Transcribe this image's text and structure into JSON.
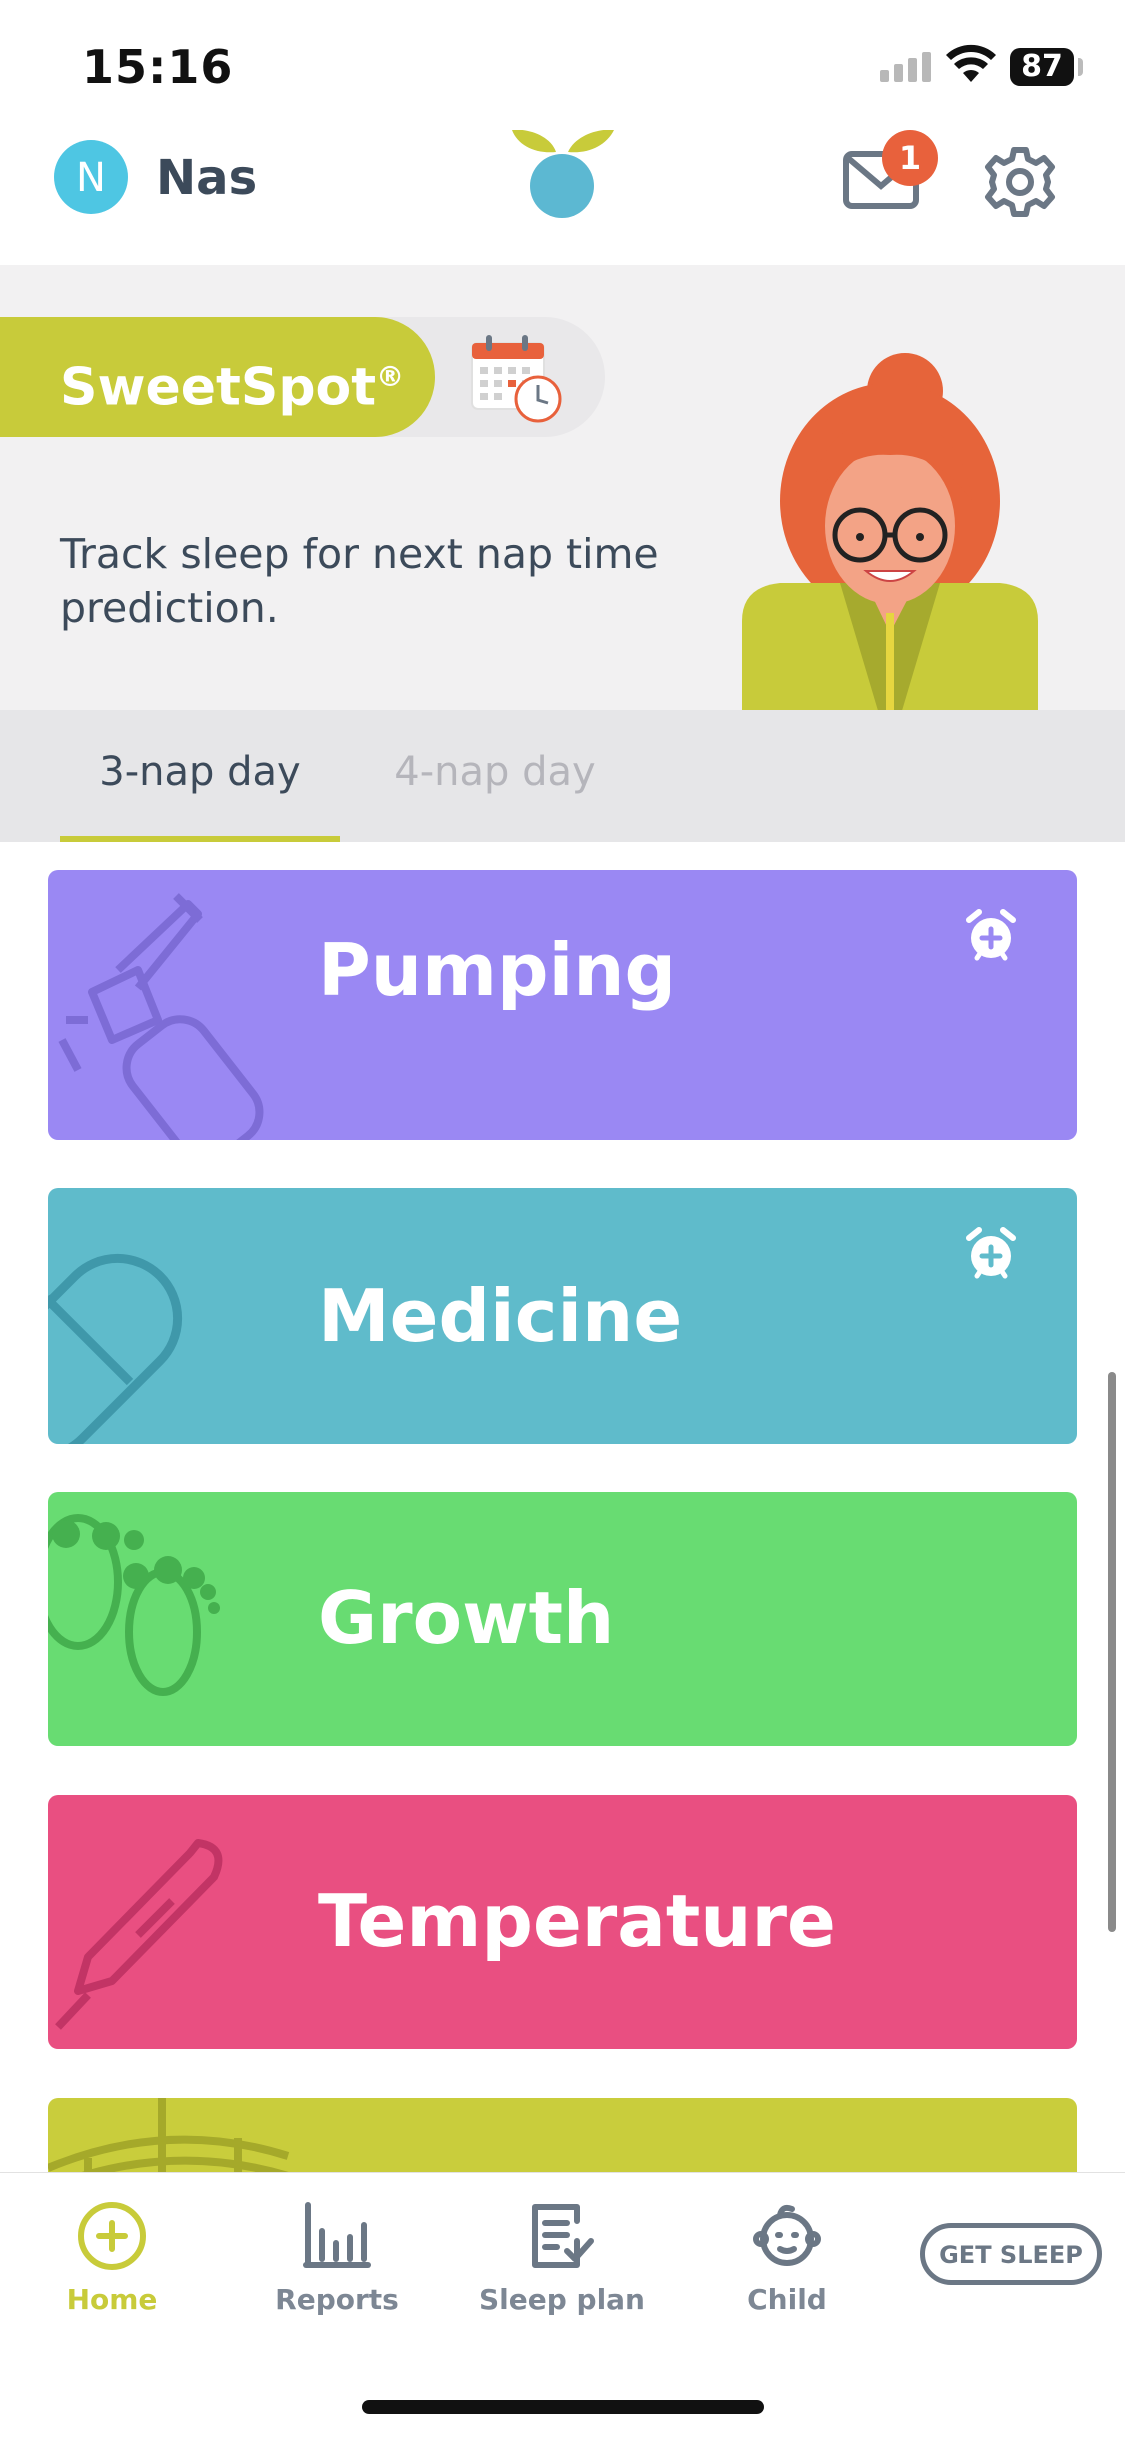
{
  "status_bar": {
    "time": "15:16",
    "battery": "87"
  },
  "header": {
    "avatar_initial": "N",
    "user_name": "Nas",
    "mail_badge": "1"
  },
  "sweetspot": {
    "title": "SweetSpot",
    "registered": "®",
    "message": "Track sleep for next nap time prediction.",
    "tabs": [
      {
        "label": "3-nap day",
        "active": true
      },
      {
        "label": "4-nap day",
        "active": false
      }
    ]
  },
  "cards": [
    {
      "label": "Pumping",
      "color": "#9a88f3",
      "icon": "breast-pump-icon",
      "has_alarm": true
    },
    {
      "label": "Medicine",
      "color": "#5fbbcb",
      "icon": "pill-capsule-icon",
      "has_alarm": true
    },
    {
      "label": "Growth",
      "color": "#68dc72",
      "icon": "footprints-icon",
      "has_alarm": false
    },
    {
      "label": "Temperature",
      "color": "#e94f81",
      "icon": "thermometer-icon",
      "has_alarm": false
    },
    {
      "label": "",
      "color": "#c9cd3c",
      "icon": "arc-icon",
      "has_alarm": false
    }
  ],
  "nav": {
    "items": [
      {
        "label": "Home",
        "icon": "plus-circle-icon",
        "active": true
      },
      {
        "label": "Reports",
        "icon": "bar-chart-icon",
        "active": false
      },
      {
        "label": "Sleep plan",
        "icon": "clipboard-check-icon",
        "active": false
      },
      {
        "label": "Child",
        "icon": "baby-face-icon",
        "active": false
      }
    ],
    "get_sleep": "GET SLEEP"
  },
  "colors": {
    "accent": "#c8cb3a",
    "text": "#3c4a5a",
    "badge": "#e8613c"
  }
}
